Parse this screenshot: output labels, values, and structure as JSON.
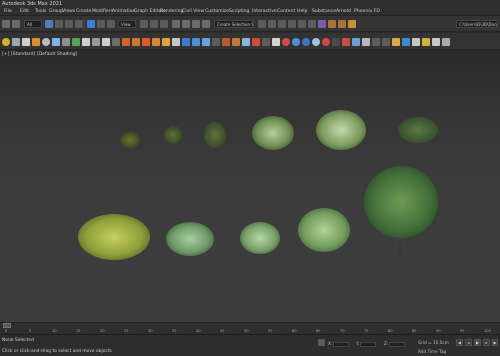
{
  "window": {
    "title": "Autodesk 3ds Max 2021"
  },
  "menu": [
    "File",
    "Edit",
    "Tools",
    "Group",
    "Views",
    "Create",
    "Modifiers",
    "Animation",
    "Graph Editors",
    "Rendering",
    "Civil View",
    "Customize",
    "Scripting",
    "Interactive",
    "Content",
    "Help",
    "Substance",
    "Arnold",
    "Phoenix FD"
  ],
  "toolbar": {
    "filter_dropdown": "All",
    "view_dropdown": "View",
    "selection_set_dropdown": "Create Selection Set",
    "workspace_path": "C:\\Users\\D\\3D\\Documents"
  },
  "viewport": {
    "label": "[+] [Standard] [Default Shading]"
  },
  "timeline": {
    "ticks": [
      "0",
      "5",
      "10",
      "15",
      "20",
      "25",
      "30",
      "35",
      "40",
      "45",
      "50",
      "55",
      "60",
      "65",
      "70",
      "75",
      "80",
      "85",
      "90",
      "95",
      "100"
    ]
  },
  "status": {
    "selection": "None Selected",
    "prompt": "Click or click-and-drag to select and move objects",
    "x_label": "X:",
    "y_label": "Y:",
    "z_label": "Z:",
    "grid": "Grid = 10.0cm",
    "time_tag": "Add Time Tag"
  },
  "colors": {
    "ui_bg": "#2b2b2b",
    "toolbar_bg": "#333333",
    "accent": "#3f7fd9"
  }
}
